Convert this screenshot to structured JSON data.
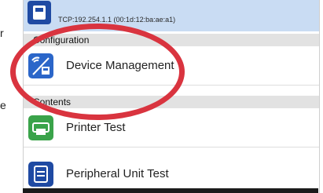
{
  "side_text": {
    "top_letter": "r",
    "middle_letter": "e"
  },
  "device": {
    "address": "TCP:192.254.1.1 (00:1d:12:ba:ae:a1)"
  },
  "sections": {
    "configuration_label": "Configuration",
    "contents_label": "Contents"
  },
  "items": {
    "device_management": "Device Management",
    "printer_test": "Printer Test",
    "peripheral_unit_test": "Peripheral Unit Test"
  },
  "colors": {
    "annotation": "#d9343f",
    "selected_row": "#c9dcf3",
    "icon_blue": "#1f4aa3",
    "icon_green": "#3aa34a"
  }
}
